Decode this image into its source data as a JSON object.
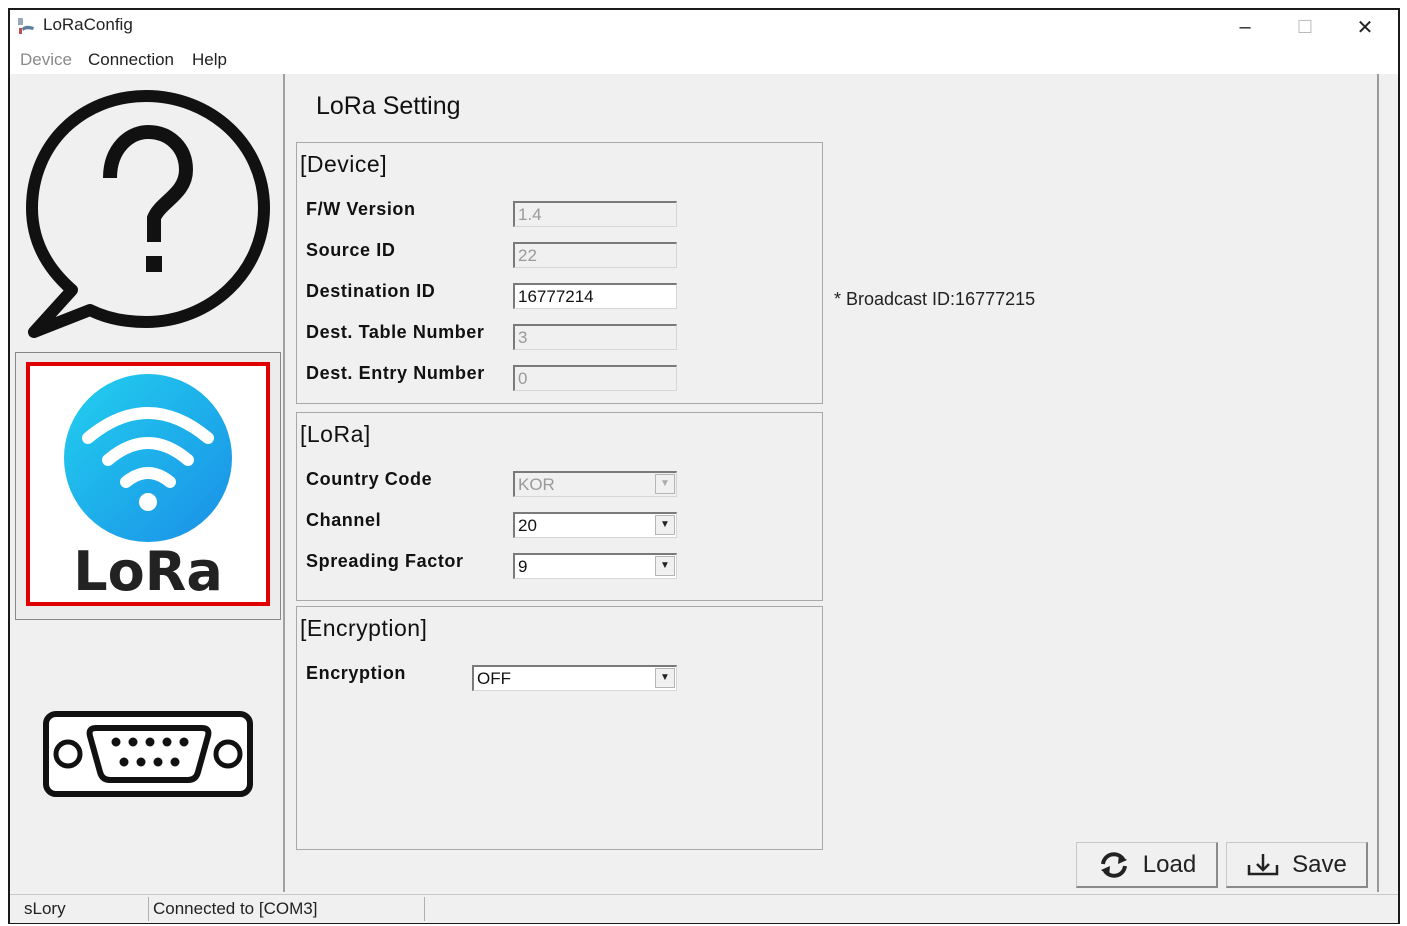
{
  "window": {
    "title": "LoRaConfig",
    "controls": {
      "minimize": "–",
      "maximize": "☐",
      "close": "✕"
    }
  },
  "menu": [
    {
      "label": "Device",
      "enabled": false
    },
    {
      "label": "Connection",
      "enabled": true
    },
    {
      "label": "Help",
      "enabled": true
    }
  ],
  "sidebar": {
    "items": [
      {
        "name": "help",
        "icon": "help-bubble-icon"
      },
      {
        "name": "lora",
        "icon": "lora-wifi-icon",
        "label": "LoRa",
        "selected": true
      },
      {
        "name": "serial",
        "icon": "serial-port-icon"
      }
    ]
  },
  "main": {
    "title": "LoRa Setting",
    "device_group": {
      "title": "[Device]",
      "fw_version": {
        "label": "F/W Version",
        "value": "1.4"
      },
      "source_id": {
        "label": "Source ID",
        "value": "22"
      },
      "destination_id": {
        "label": "Destination ID",
        "value": "16777214"
      },
      "dest_table_number": {
        "label": "Dest. Table Number",
        "value": "3"
      },
      "dest_entry_number": {
        "label": "Dest. Entry Number",
        "value": "0"
      }
    },
    "broadcast_note": "* Broadcast ID:16777215",
    "lora_group": {
      "title": "[LoRa]",
      "country_code": {
        "label": "Country Code",
        "value": "KOR"
      },
      "channel": {
        "label": "Channel",
        "value": "20"
      },
      "spreading_factor": {
        "label": "Spreading Factor",
        "value": "9"
      }
    },
    "encryption_group": {
      "title": "[Encryption]",
      "encryption": {
        "label": "Encryption",
        "value": "OFF"
      }
    },
    "buttons": {
      "load": "Load",
      "save": "Save"
    }
  },
  "status": {
    "app": "sLory",
    "connection": "Connected to [COM3]"
  },
  "colors": {
    "highlight": "#e00000",
    "lora_blue": "#1aa0e8"
  }
}
